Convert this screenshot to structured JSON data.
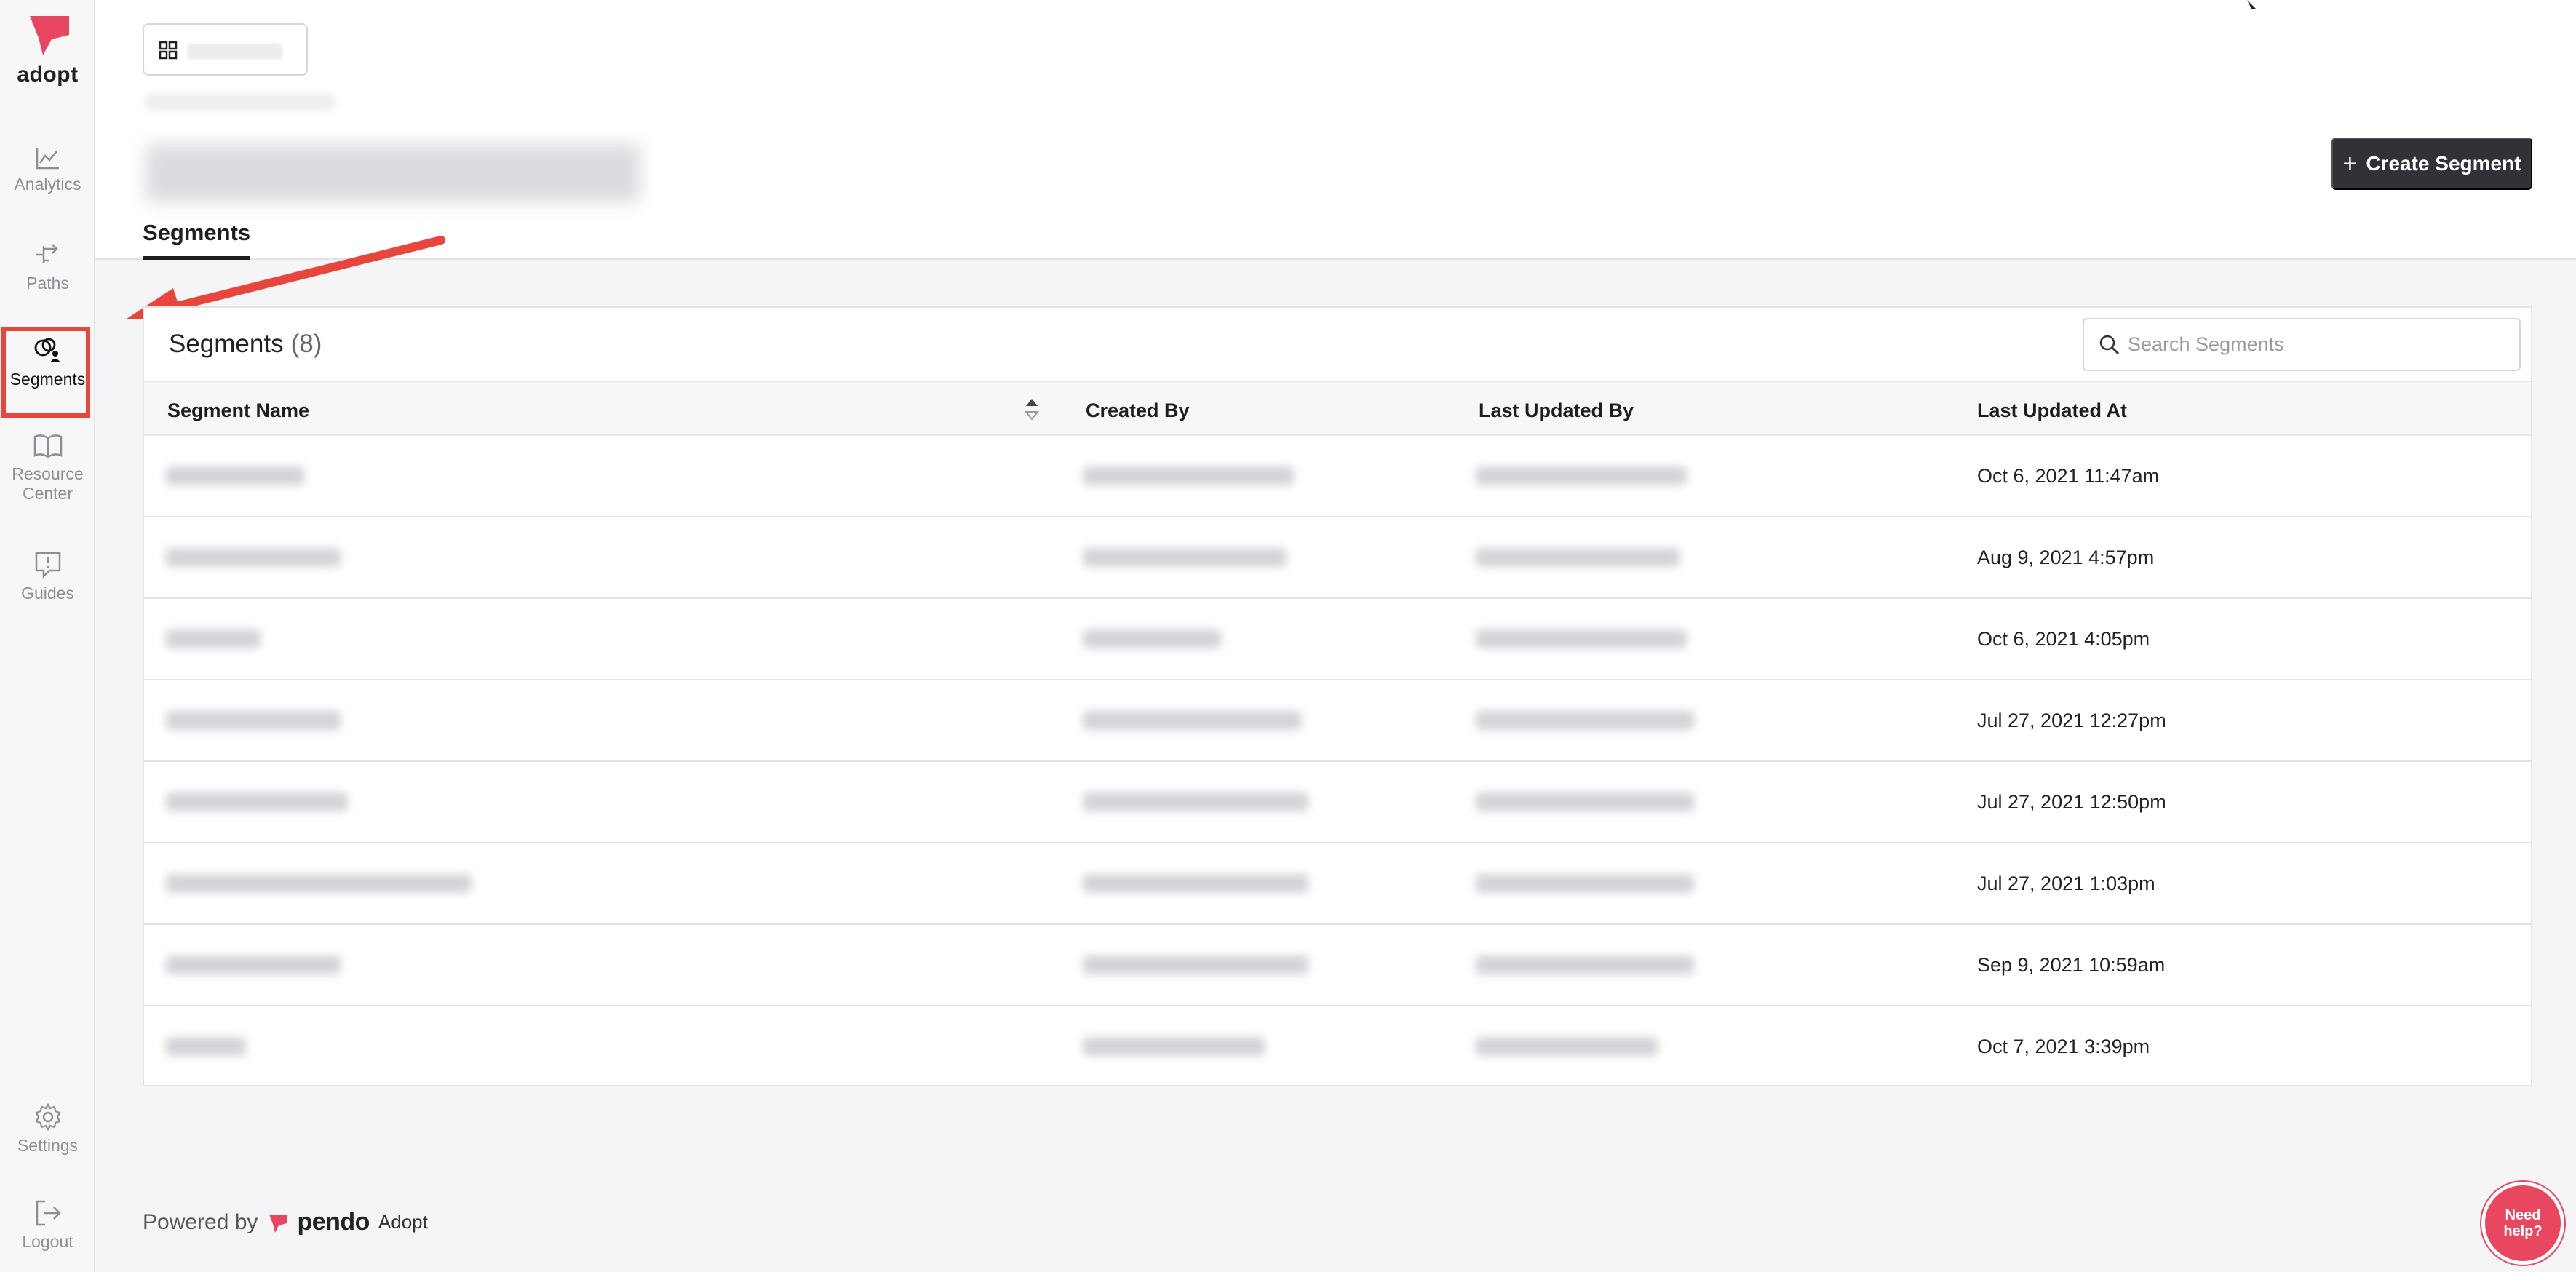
{
  "sidebar": {
    "logo_text": "adopt",
    "items": [
      {
        "label": "Analytics"
      },
      {
        "label": "Paths"
      },
      {
        "label": "Segments"
      },
      {
        "label": "Resource Center"
      },
      {
        "label": "Guides"
      },
      {
        "label": "Settings"
      },
      {
        "label": "Logout"
      }
    ]
  },
  "header": {
    "create_label": "Create Segment",
    "tab": "Segments"
  },
  "table": {
    "title": "Segments",
    "count": "(8)",
    "search_placeholder": "Search Segments",
    "columns": [
      "Segment Name",
      "Created By",
      "Last Updated By",
      "Last Updated At"
    ],
    "rows": [
      {
        "updated_at": "Oct 6, 2021 11:47am"
      },
      {
        "updated_at": "Aug 9, 2021 4:57pm"
      },
      {
        "updated_at": "Oct 6, 2021 4:05pm"
      },
      {
        "updated_at": "Jul 27, 2021 12:27pm"
      },
      {
        "updated_at": "Jul 27, 2021 12:50pm"
      },
      {
        "updated_at": "Jul 27, 2021 1:03pm"
      },
      {
        "updated_at": "Sep 9, 2021 10:59am"
      },
      {
        "updated_at": "Oct 7, 2021 3:39pm"
      }
    ]
  },
  "footer": {
    "powered_by": "Powered by",
    "brand": "pendo",
    "product": "Adopt",
    "help": "Need help?"
  },
  "colors": {
    "accent": "#e8463c",
    "brand_pink": "#e8475f",
    "button_dark": "#303238"
  },
  "icons": [
    "pendo-logo-icon",
    "analytics-icon",
    "paths-icon",
    "segments-icon",
    "resource-center-icon",
    "guides-icon",
    "settings-icon",
    "logout-icon",
    "grid-icon",
    "search-icon",
    "sort-icon",
    "plus-icon"
  ]
}
